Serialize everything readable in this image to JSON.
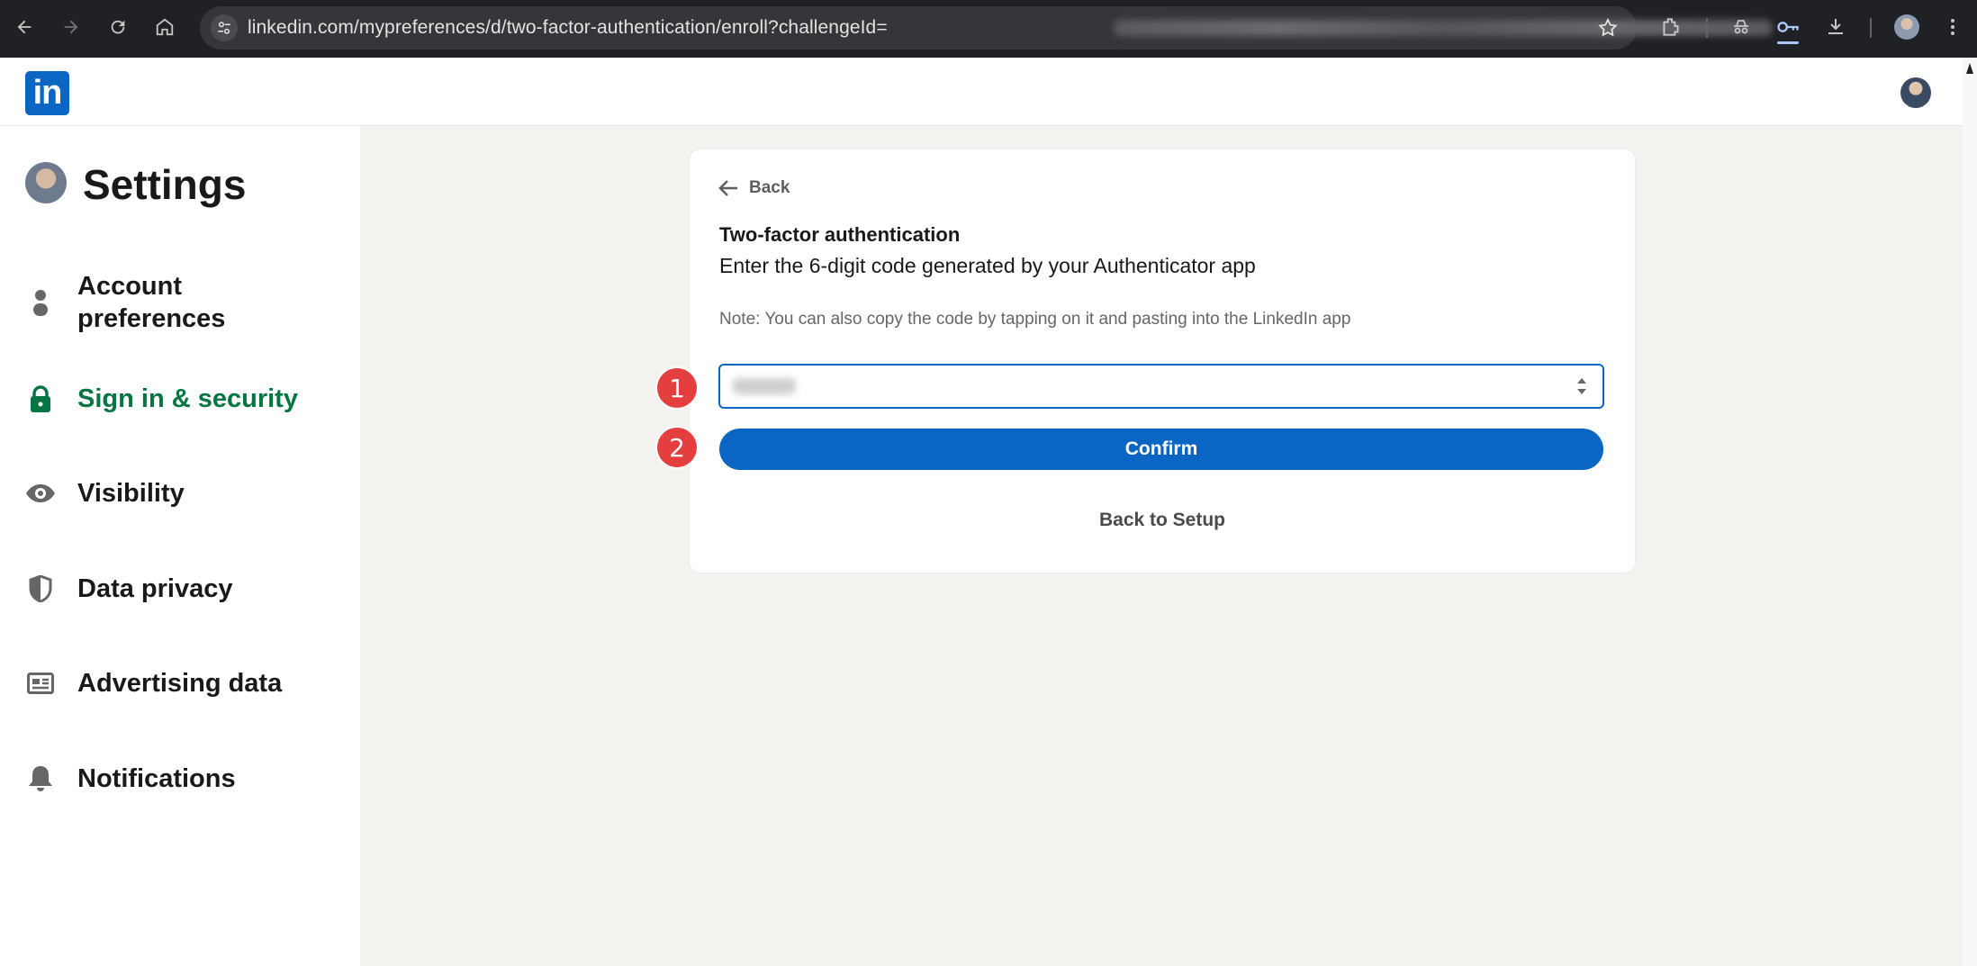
{
  "browser": {
    "url_visible": "linkedin.com/mypreferences/d/two-factor-authentication/enroll?challengeId=",
    "icons": [
      "back-arrow-icon",
      "forward-arrow-icon",
      "reload-icon",
      "home-icon",
      "site-settings-icon",
      "bookmark-star-icon",
      "extensions-icon",
      "incognito-icon",
      "password-key-icon",
      "download-icon",
      "profile-avatar",
      "more-vert-icon"
    ]
  },
  "header": {
    "logo_text": "in",
    "brand_color": "#0a66c2"
  },
  "sidebar": {
    "title": "Settings",
    "active_color": "#057642",
    "items": [
      {
        "label": "Account preferences",
        "icon": "person-icon"
      },
      {
        "label": "Sign in & security",
        "icon": "lock-icon",
        "active": true
      },
      {
        "label": "Visibility",
        "icon": "eye-icon"
      },
      {
        "label": "Data privacy",
        "icon": "shield-icon"
      },
      {
        "label": "Advertising data",
        "icon": "newspaper-icon"
      },
      {
        "label": "Notifications",
        "icon": "bell-icon"
      }
    ]
  },
  "card": {
    "back_label": "Back",
    "title": "Two-factor authentication",
    "subtitle": "Enter the 6-digit code generated by your Authenticator app",
    "note": "Note: You can also copy the code by tapping on it and pasting into the LinkedIn app",
    "confirm_label": "Confirm",
    "back_to_setup_label": "Back to Setup"
  },
  "markers": [
    "1",
    "2"
  ],
  "colors": {
    "marker": "#e53e3e",
    "page_bg": "#f4f2ee"
  }
}
